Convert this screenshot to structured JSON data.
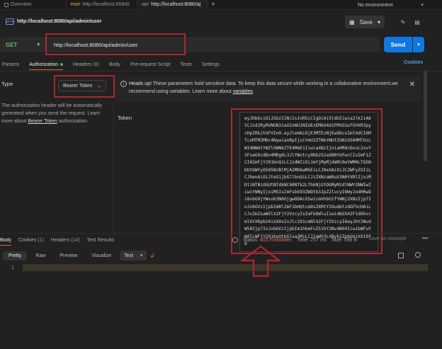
{
  "tabs": [
    {
      "label": "Overview",
      "method": "",
      "active": false
    },
    {
      "label": "http://localhost:8084/i",
      "method": "POST",
      "active": false
    },
    {
      "label": "http://localhost:8080/aj",
      "method": "GET",
      "active": true
    }
  ],
  "environment": "No environment",
  "request": {
    "title": "http://localhost:8080/api/admin/user",
    "method": "GET",
    "url": "http://localhost:8080/api/admin/user",
    "save_label": "Save",
    "send_label": "Send"
  },
  "request_tabs": [
    {
      "label": "Params",
      "count": "",
      "active": false
    },
    {
      "label": "Authorization",
      "count": "",
      "active": true
    },
    {
      "label": "Headers",
      "count": "(8)",
      "active": false
    },
    {
      "label": "Body",
      "count": "",
      "active": false
    },
    {
      "label": "Pre-request Script",
      "count": "",
      "active": false
    },
    {
      "label": "Tests",
      "count": "",
      "active": false
    },
    {
      "label": "Settings",
      "count": "",
      "active": false
    }
  ],
  "cookies_label": "Cookies",
  "auth": {
    "type_label": "Type",
    "type_value": "Bearer Token",
    "description_1": "The authorization header will be automatically generated when you send the request. Learn more about ",
    "description_link": "Bearer Token",
    "description_2": " authorization.",
    "token_label": "Token",
    "token_value": "eyJhbGciOiJSUzI1NiIsInR5cCIgOiAiSldUIiwia2lkIiA6ICJzd2RyRVNGN3JaX2xWU1NIUExEMkU4d1FMVG1wTGVkR3pycHpIRkJtUFVIn0.eyJleHAiOjE3MTEzNjEwODcsImlhdCI6MTcxMTM2MDc4NywianRpIjoiYmU2ZTNkYWUtZGNiOS00MTUzLWI4NWUtYWZlOWNkZTE4MmE1IiwiaXNzIjoiaHR0cDovL2xvY2FsaG9zdDo4MDg0L3JlYWxtcy9Db252aXN0YUFwcCIsImF1ZCI6ImFjY291bnQiLCJzdWIiOiJmYjMyMjdmMi0wYWM0LTQ5NDUtOWYyOS05NzBlMjA2MDkwMGEiLCJ0eXAiOiJCZWFyZXIiLCJhenAiOiJteS1jbGllbnQiLCJzZXNzaW9uX3N0YXRlIjoiMDliNTNiOGUtNTdkNC00NTk2LThkNjUtOGMyMzdlNWY2NWIwIiwiYWNyIjoiMSIsImFsbG93ZWQtb3JpZ2lucyI6WyJodHRwOi8vbG9jYWxob3N0OjgwODAiXSwicmVhbG1fYWNjZXNzIjp7InJvbGVzIjpbImRlZmF1bHQtcm9sZXMtY29udmlzdGFhcHAiLCJvZmZsaW5lX2FjY2VzcyIsImFkbWluIiwidW1hX2F1dGhvcml6YXRpb24iXX0sInJlc291cmNlX2FjY2VzcyI6eyJhY2NvdW50Ijp7InJvbGVzIjpbIm1hbmFnZS1hY2NvdW50IiwibWFuYWdlLWFjY291bnQtbGlua3MiLCJ2aWV3LXByb2ZpbGUiXX19fQ"
  },
  "banner": {
    "heading": "Heads up!",
    "message": " These parameters hold sensitive data. To keep this data secure while working in a collaborative environment,we recommend using variables. Learn more about ",
    "link": "variables",
    "end": "."
  },
  "response_tabs": [
    {
      "label": "Body",
      "count": "",
      "active": true
    },
    {
      "label": "Cookies",
      "count": "(1)",
      "active": false
    },
    {
      "label": "Headers",
      "count": "(14)",
      "active": false
    },
    {
      "label": "Test Results",
      "count": "",
      "active": false
    }
  ],
  "status": {
    "status_label": "Status:",
    "status_value": "403 Forbidden",
    "time_label": "Time:",
    "time_value": "257 ms",
    "size_label": "Size:",
    "size_value": "598 B",
    "save_example": "Save as example"
  },
  "format_tabs": [
    "Pretty",
    "Raw",
    "Preview",
    "Visualize"
  ],
  "format_type": "Text",
  "editor": {
    "line": "1"
  },
  "colors": {
    "accent": "#e06b2f",
    "send": "#0b78e3",
    "annotation": "#b3232f",
    "forbidden": "#e36a5f"
  }
}
